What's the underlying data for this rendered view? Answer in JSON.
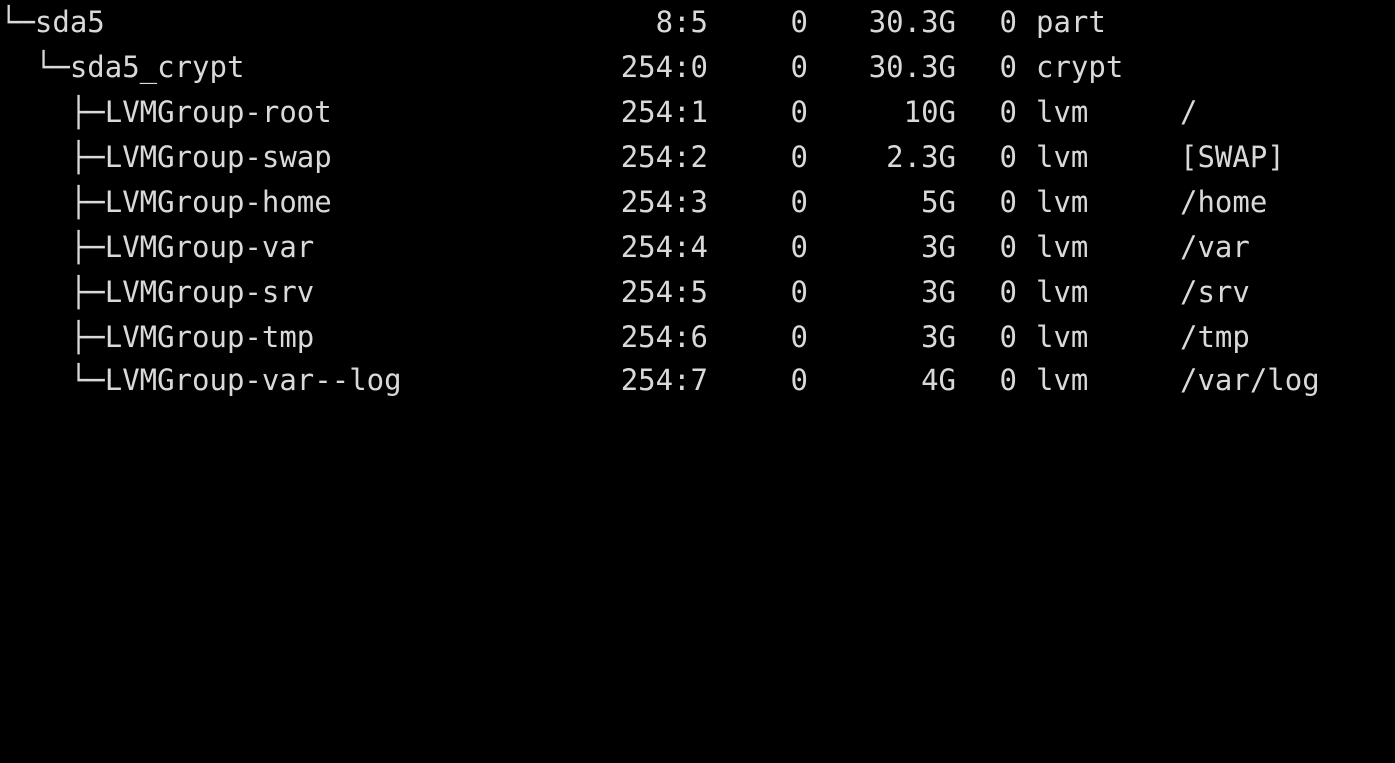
{
  "terminal": {
    "bg": "#000000",
    "fg": "#d9d9d9",
    "rows": [
      {
        "name": "└─sda5",
        "majmin": "8:5",
        "rm": "0",
        "size": "30.3G",
        "ro": "0",
        "type": "part",
        "mount": ""
      },
      {
        "name": "  └─sda5_crypt",
        "majmin": "254:0",
        "rm": "0",
        "size": "30.3G",
        "ro": "0",
        "type": "crypt",
        "mount": ""
      },
      {
        "name": "    ├─LVMGroup-root",
        "majmin": "254:1",
        "rm": "0",
        "size": "10G",
        "ro": "0",
        "type": "lvm",
        "mount": "/"
      },
      {
        "name": "    ├─LVMGroup-swap",
        "majmin": "254:2",
        "rm": "0",
        "size": "2.3G",
        "ro": "0",
        "type": "lvm",
        "mount": "[SWAP]"
      },
      {
        "name": "    ├─LVMGroup-home",
        "majmin": "254:3",
        "rm": "0",
        "size": "5G",
        "ro": "0",
        "type": "lvm",
        "mount": "/home"
      },
      {
        "name": "    ├─LVMGroup-var",
        "majmin": "254:4",
        "rm": "0",
        "size": "3G",
        "ro": "0",
        "type": "lvm",
        "mount": "/var"
      },
      {
        "name": "    ├─LVMGroup-srv",
        "majmin": "254:5",
        "rm": "0",
        "size": "3G",
        "ro": "0",
        "type": "lvm",
        "mount": "/srv"
      },
      {
        "name": "    ├─LVMGroup-tmp",
        "majmin": "254:6",
        "rm": "0",
        "size": "3G",
        "ro": "0",
        "type": "lvm",
        "mount": "/tmp"
      },
      {
        "name": "    └─LVMGroup-var--log",
        "majmin": "254:7",
        "rm": "0",
        "size": "4G",
        "ro": "0",
        "type": "lvm",
        "mount": "/var/log"
      }
    ]
  }
}
